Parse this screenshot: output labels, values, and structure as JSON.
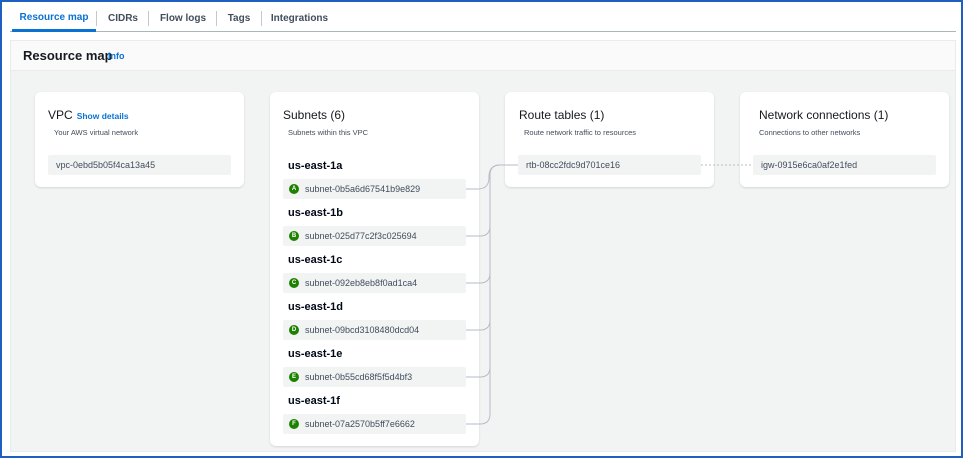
{
  "tabs": [
    {
      "label": "Resource map"
    },
    {
      "label": "CIDRs"
    },
    {
      "label": "Flow logs"
    },
    {
      "label": "Tags"
    },
    {
      "label": "Integrations"
    }
  ],
  "resource_map": {
    "title": "Resource map",
    "info_label": "Info"
  },
  "vpc": {
    "title": "VPC",
    "show_details": "Show details",
    "subtitle": "Your AWS virtual network",
    "id": "vpc-0ebd5b05f4ca13a45"
  },
  "subnets": {
    "title": "Subnets (6)",
    "subtitle": "Subnets within this VPC",
    "groups": [
      {
        "az": "us-east-1a",
        "badge": "A",
        "id": "subnet-0b5a6d67541b9e829"
      },
      {
        "az": "us-east-1b",
        "badge": "B",
        "id": "subnet-025d77c2f3c025694"
      },
      {
        "az": "us-east-1c",
        "badge": "C",
        "id": "subnet-092eb8eb8f0ad1ca4"
      },
      {
        "az": "us-east-1d",
        "badge": "D",
        "id": "subnet-09bcd3108480dcd04"
      },
      {
        "az": "us-east-1e",
        "badge": "E",
        "id": "subnet-0b55cd68f5f5d4bf3"
      },
      {
        "az": "us-east-1f",
        "badge": "F",
        "id": "subnet-07a2570b5ff7e6662"
      }
    ]
  },
  "route_tables": {
    "title": "Route tables (1)",
    "subtitle": "Route network traffic to resources",
    "id": "rtb-08cc2fdc9d701ce16"
  },
  "network_connections": {
    "title": "Network connections (1)",
    "subtitle": "Connections to other networks",
    "id": "igw-0915e6ca0af2e1fed"
  },
  "colors": {
    "accent": "#0972d3",
    "frame": "#1f5fbf",
    "badge": "#1d8102",
    "background": "#f2f3f3"
  }
}
